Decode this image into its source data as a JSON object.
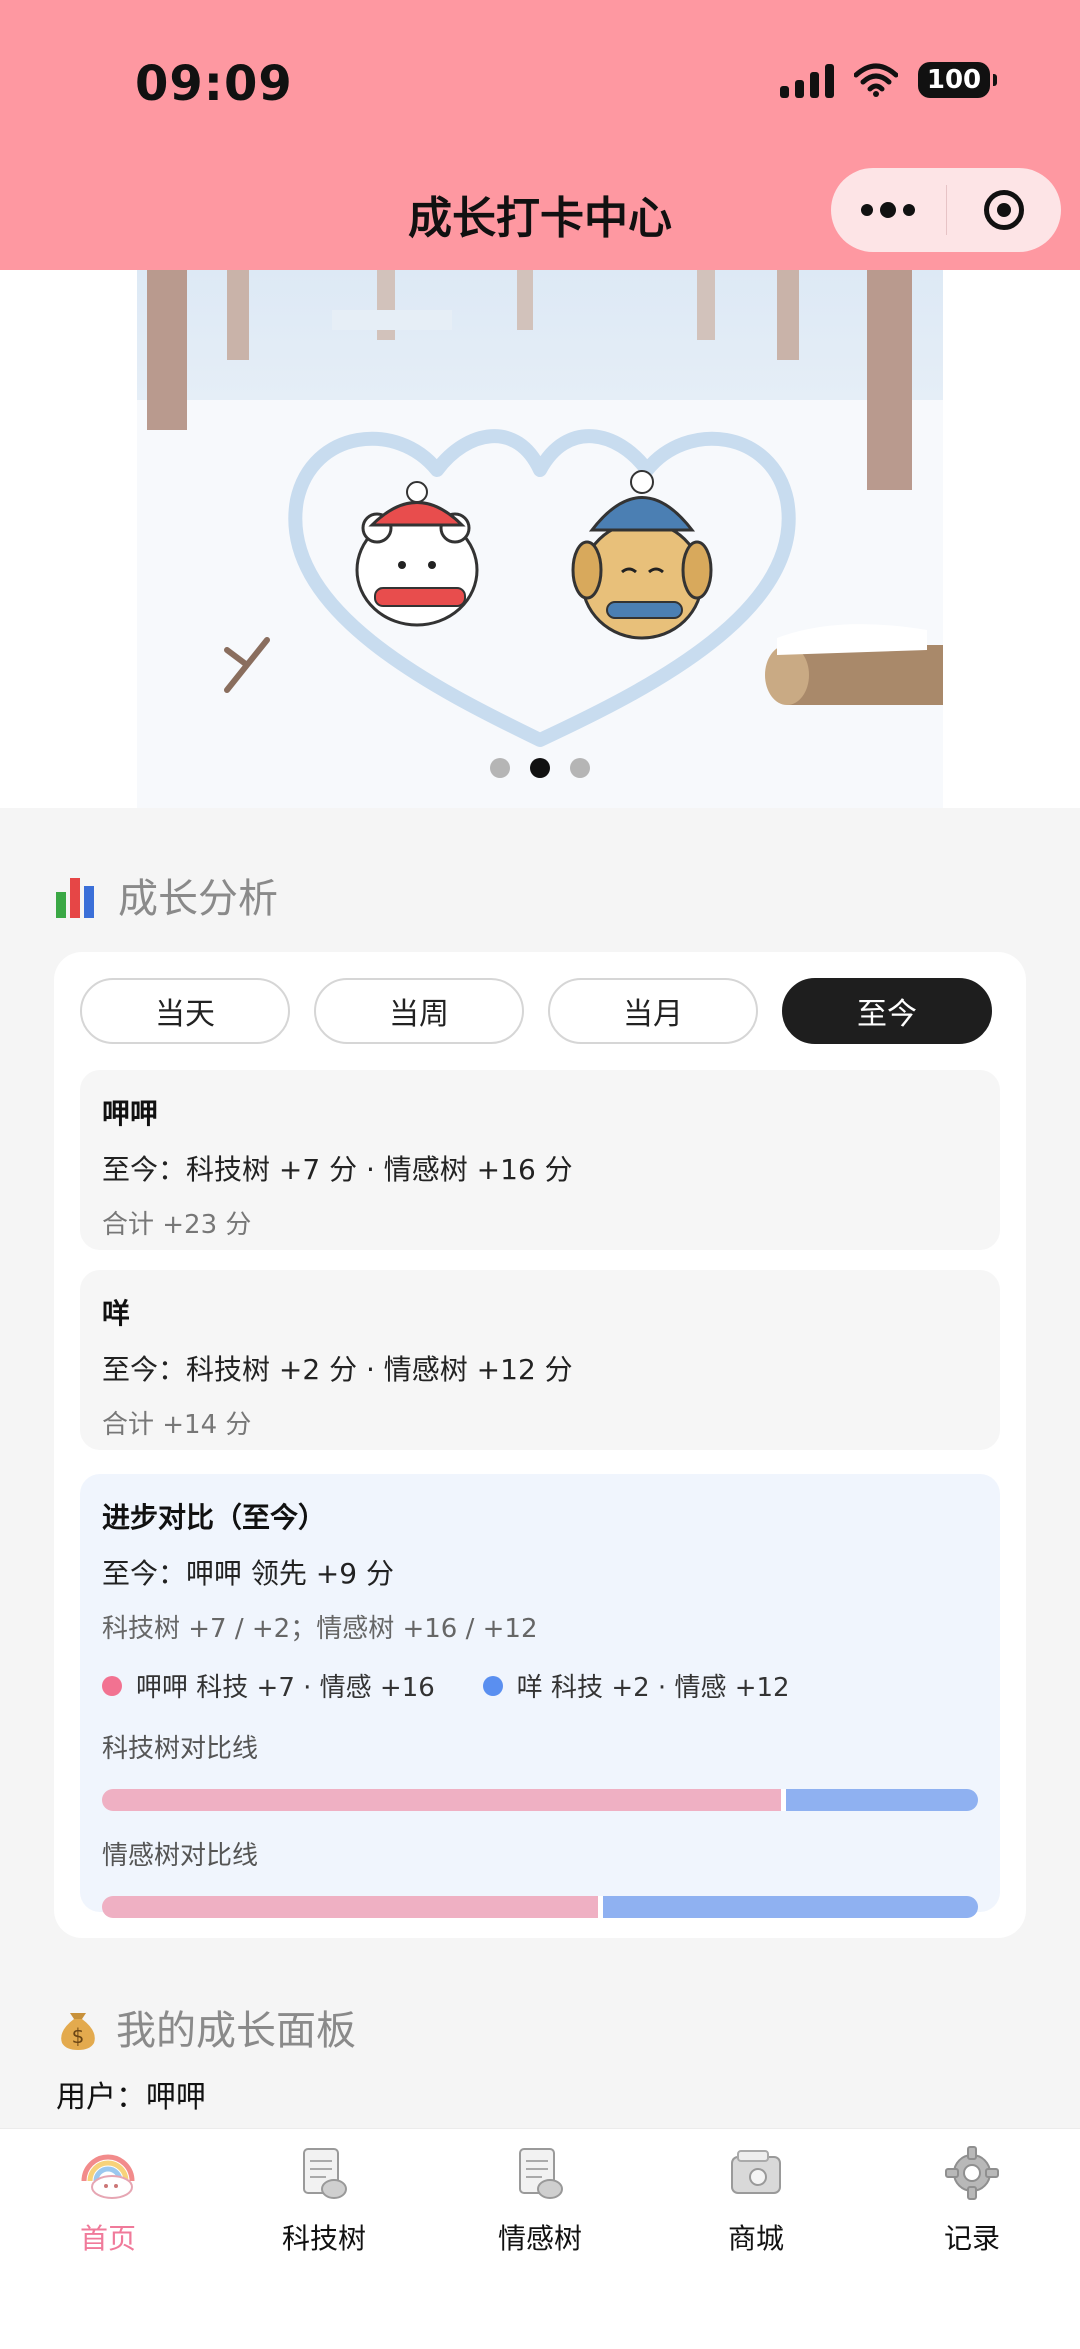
{
  "status_bar": {
    "time": "09:09",
    "battery": "100"
  },
  "nav": {
    "title": "成长打卡中心"
  },
  "banner": {
    "page_count": 3,
    "active_page": 2
  },
  "growth_section": {
    "title": "成长分析",
    "icon": "bar-chart-icon"
  },
  "period_tabs": [
    {
      "label": "当天",
      "active": false
    },
    {
      "label": "当周",
      "active": false
    },
    {
      "label": "当月",
      "active": false
    },
    {
      "label": "至今",
      "active": true
    }
  ],
  "users": [
    {
      "name": "呷呷",
      "detail": "至今：科技树 +7 分 · 情感树 +16 分",
      "total": "合计 +23 分"
    },
    {
      "name": "咩",
      "detail": "至今：科技树 +2 分 · 情感树 +12 分",
      "total": "合计 +14 分"
    }
  ],
  "comparison": {
    "title": "进步对比（至今）",
    "summary": "至今：呷呷 领先 +9 分",
    "detail": "科技树 +7 / +2；情感树 +16 / +12",
    "legend": [
      {
        "label": "呷呷 科技 +7 · 情感 +16",
        "color": "#f27291"
      },
      {
        "label": "咩 科技 +2 · 情感 +12",
        "color": "#5a8ff0"
      }
    ],
    "tech_label": "科技树对比线",
    "emotion_label": "情感树对比线",
    "tech_split": 0.78,
    "emotion_split": 0.57,
    "left_color": "#efb0c3",
    "right_color": "#8fb1f1"
  },
  "panel_section": {
    "title": "我的成长面板",
    "icon": "money-bag-icon"
  },
  "user_line": "用户：呷呷",
  "tabbar": [
    {
      "label": "首页",
      "icon": "rainbow-cloud-icon",
      "active": true
    },
    {
      "label": "科技树",
      "icon": "notepad-icon",
      "active": false
    },
    {
      "label": "情感树",
      "icon": "notepad-icon",
      "active": false
    },
    {
      "label": "商城",
      "icon": "wallet-icon",
      "active": false
    },
    {
      "label": "记录",
      "icon": "gear-icon",
      "active": false
    }
  ],
  "colors": {
    "header": "#fe98a1",
    "accent": "#f07a9a"
  }
}
